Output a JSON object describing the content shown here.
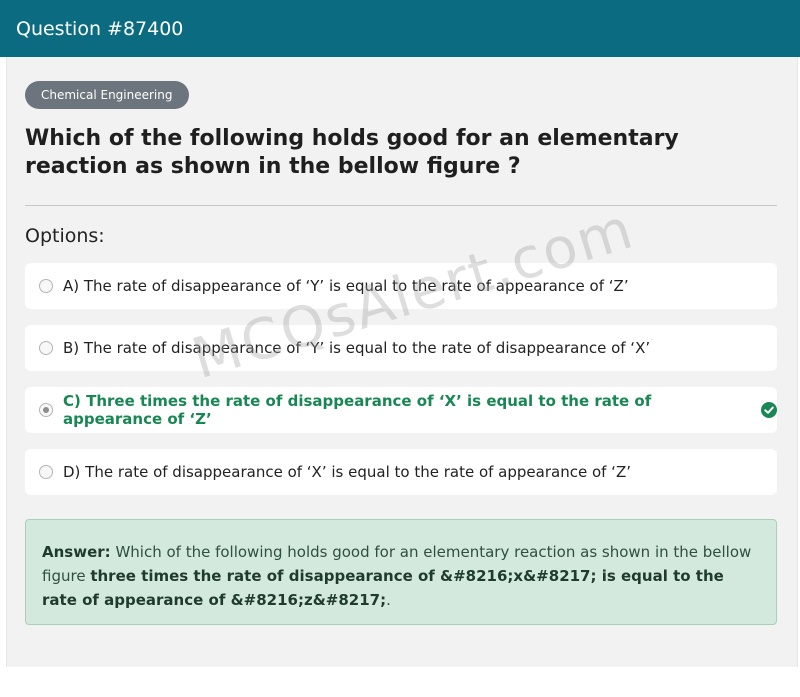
{
  "header": {
    "title": "Question #87400"
  },
  "category": "Chemical Engineering",
  "question": "Which of the following holds good for an elementary reaction as shown in the bellow figure ?",
  "options_label": "Options:",
  "options": [
    {
      "label": "A) The rate of disappearance of ‘Y’ is equal to the rate of appearance of ‘Z’",
      "selected": false,
      "correct": false
    },
    {
      "label": "B) The rate of disappearance of ‘Y’ is equal to the rate of disappearance of ‘X’",
      "selected": false,
      "correct": false
    },
    {
      "label": "C) Three times the rate of disappearance of ‘X’ is equal to the rate of appearance of ‘Z’",
      "selected": true,
      "correct": true
    },
    {
      "label": "D) The rate of disappearance of ‘X’ is equal to the rate of appearance of ‘Z’",
      "selected": false,
      "correct": false
    }
  ],
  "answer": {
    "prefix": "Answer:",
    "text": "Which of the following holds good for an elementary reaction as shown in the bellow figure",
    "bold": "three times the rate of disappearance of &#8216;x&#8217; is equal to the rate of appearance of &#8216;z&#8217;",
    "suffix": "."
  },
  "watermark": "MCQsAlert.com",
  "colors": {
    "header": "#0b6b80",
    "correct": "#198754",
    "answer_bg": "#d4e9de"
  }
}
